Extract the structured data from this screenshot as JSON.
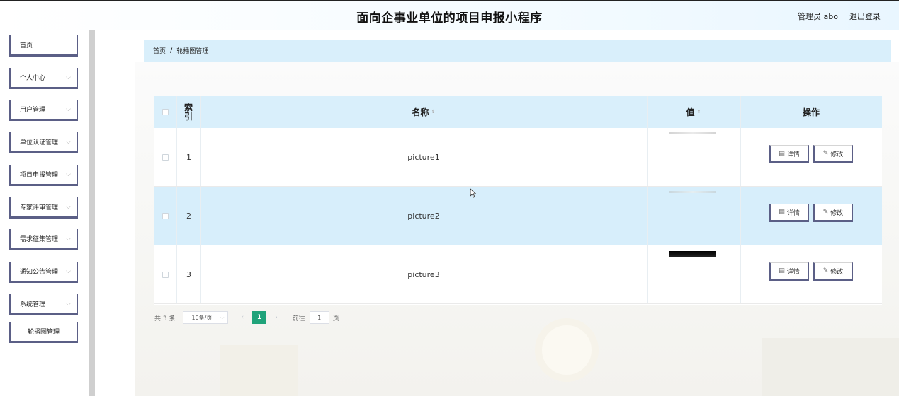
{
  "header": {
    "title": "面向企事业单位的项目申报小程序",
    "user": "管理员 abo",
    "logout": "退出登录"
  },
  "sidebar": {
    "items": [
      {
        "label": "首页",
        "has_chevron": false
      },
      {
        "label": "个人中心",
        "has_chevron": true
      },
      {
        "label": "用户管理",
        "has_chevron": true
      },
      {
        "label": "单位认证管理",
        "has_chevron": true
      },
      {
        "label": "项目申报管理",
        "has_chevron": true
      },
      {
        "label": "专家评审管理",
        "has_chevron": true
      },
      {
        "label": "需求征集管理",
        "has_chevron": true
      },
      {
        "label": "通知公告管理",
        "has_chevron": true
      },
      {
        "label": "系统管理",
        "has_chevron": true
      },
      {
        "label": "轮播图管理",
        "has_chevron": false
      }
    ]
  },
  "breadcrumb": {
    "home": "首页",
    "separator": "/",
    "current": "轮播图管理"
  },
  "table": {
    "columns": {
      "index": "索引",
      "name": "名称",
      "value": "值",
      "actions": "操作"
    },
    "rows": [
      {
        "index": "1",
        "name": "picture1",
        "thumb": "light"
      },
      {
        "index": "2",
        "name": "picture2",
        "thumb": "light"
      },
      {
        "index": "3",
        "name": "picture3",
        "thumb": "dark"
      }
    ],
    "detail_label": "详情",
    "edit_label": "修改"
  },
  "pagination": {
    "total": "共 3 条",
    "page_size": "10条/页",
    "current_page": "1",
    "goto_label": "前往",
    "goto_value": "1",
    "page_suffix": "页"
  },
  "colors": {
    "accent": "#1fa37a",
    "header_bg": "#d9effb",
    "border_accent": "#5b5f86"
  }
}
